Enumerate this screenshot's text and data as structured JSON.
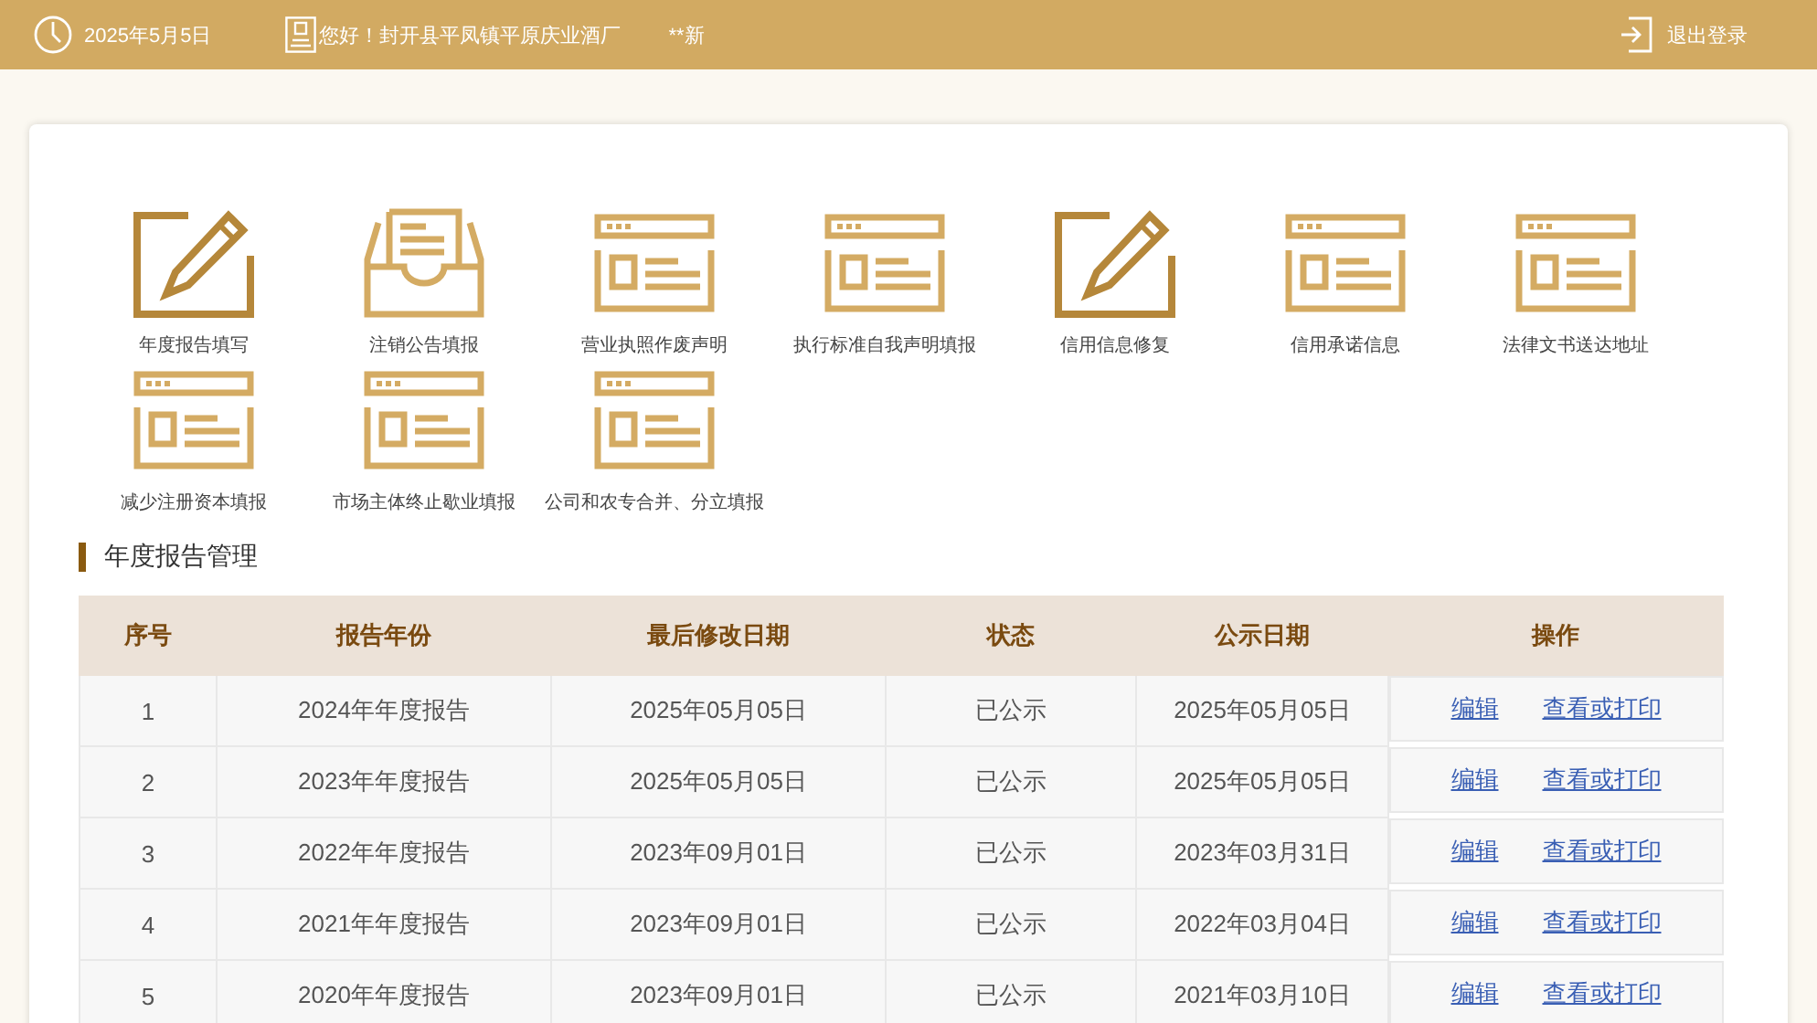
{
  "header": {
    "date": "2025年5月5日",
    "greeting": "您好！封开县平凤镇平原庆业酒厂",
    "user": "**新",
    "logout": "退出登录"
  },
  "shortcuts": [
    {
      "label": "年度报告填写",
      "kind": "pencil"
    },
    {
      "label": "注销公告填报",
      "kind": "tray"
    },
    {
      "label": "营业执照作废声明",
      "kind": "form"
    },
    {
      "label": "执行标准自我声明填报",
      "kind": "form"
    },
    {
      "label": "信用信息修复",
      "kind": "pencil"
    },
    {
      "label": "信用承诺信息",
      "kind": "form"
    },
    {
      "label": "法律文书送达地址",
      "kind": "form"
    },
    {
      "label": "减少注册资本填报",
      "kind": "form"
    },
    {
      "label": "市场主体终止歇业填报",
      "kind": "form"
    },
    {
      "label": "公司和农专合并、分立填报",
      "kind": "form"
    }
  ],
  "section_title": "年度报告管理",
  "table": {
    "columns": [
      "序号",
      "报告年份",
      "最后修改日期",
      "状态",
      "公示日期",
      "操作"
    ],
    "rows": [
      {
        "no": "1",
        "year": "2024年年度报告",
        "modified": "2025年05月05日",
        "status": "已公示",
        "published": "2025年05月05日",
        "actions": [
          "编辑",
          "查看或打印"
        ]
      },
      {
        "no": "2",
        "year": "2023年年度报告",
        "modified": "2025年05月05日",
        "status": "已公示",
        "published": "2025年05月05日",
        "actions": [
          "编辑",
          "查看或打印"
        ]
      },
      {
        "no": "3",
        "year": "2022年年度报告",
        "modified": "2023年09月01日",
        "status": "已公示",
        "published": "2023年03月31日",
        "actions": [
          "编辑",
          "查看或打印"
        ]
      },
      {
        "no": "4",
        "year": "2021年年度报告",
        "modified": "2023年09月01日",
        "status": "已公示",
        "published": "2022年03月04日",
        "actions": [
          "编辑",
          "查看或打印"
        ]
      },
      {
        "no": "5",
        "year": "2020年年度报告",
        "modified": "2023年09月01日",
        "status": "已公示",
        "published": "2021年03月10日",
        "actions": [
          "编辑",
          "查看或打印"
        ]
      }
    ]
  }
}
